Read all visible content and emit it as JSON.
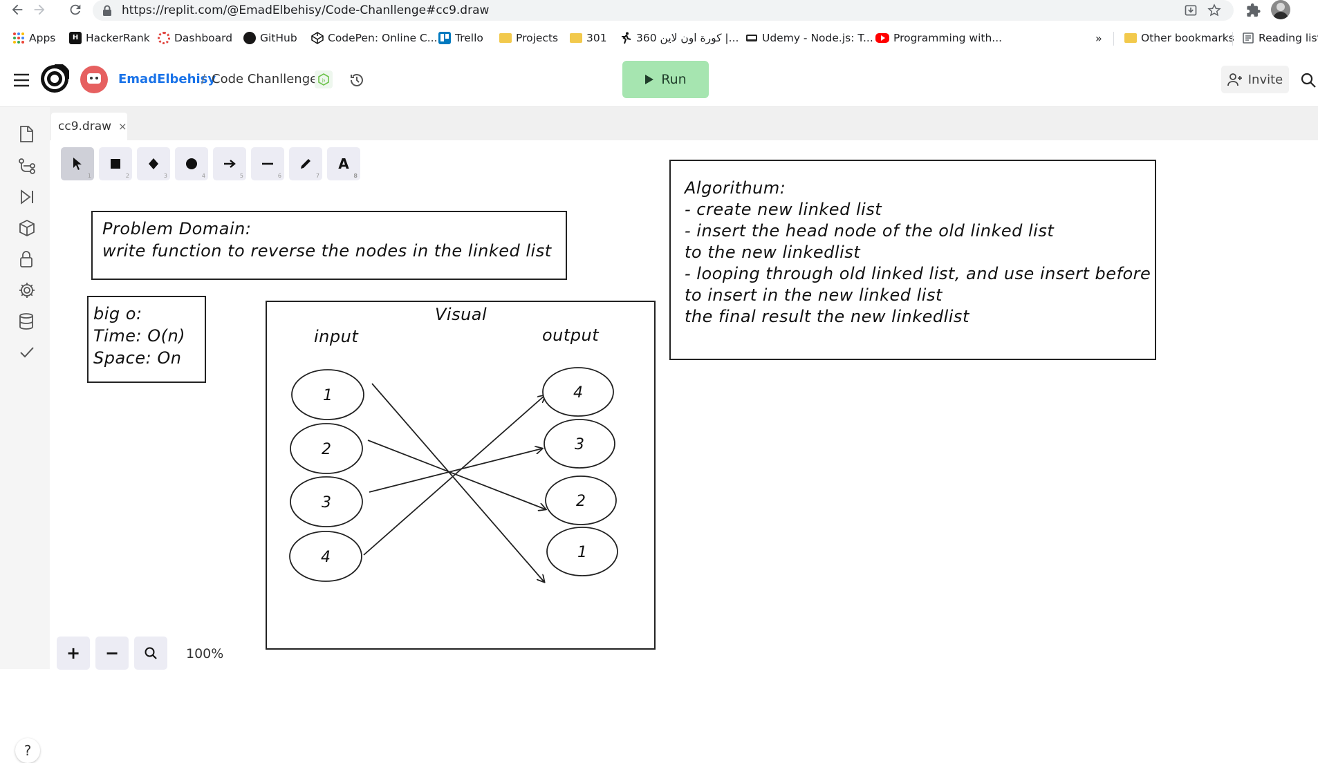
{
  "browser": {
    "url": "https://replit.com/@EmadElbehisy/Code-Chanllenge#cc9.draw",
    "bookmarks": [
      {
        "label": "Apps",
        "icon": "apps-grid-icon"
      },
      {
        "label": "HackerRank",
        "icon": "hackerrank-icon"
      },
      {
        "label": "Dashboard",
        "icon": "dashboard-icon"
      },
      {
        "label": "GitHub",
        "icon": "github-icon"
      },
      {
        "label": "CodePen: Online C...",
        "icon": "codepen-icon"
      },
      {
        "label": "Trello",
        "icon": "trello-icon"
      },
      {
        "label": "Projects",
        "icon": "folder-icon"
      },
      {
        "label": "301",
        "icon": "folder-icon"
      },
      {
        "label": "360 كورة اون لاين |...",
        "icon": "runner-icon"
      },
      {
        "label": "Udemy - Node.js: T...",
        "icon": "udemy-icon"
      },
      {
        "label": "Programming with...",
        "icon": "youtube-icon"
      }
    ],
    "overflow": "»",
    "other_bookmarks": "Other bookmarks",
    "reading_list": "Reading list"
  },
  "header": {
    "user": "EmadElbehisy",
    "separator": "/",
    "repl_name": "Code Chanllenge",
    "run_label": "Run",
    "invite_label": "Invite"
  },
  "tab": {
    "filename": "cc9.draw",
    "close": "×"
  },
  "toolbar": {
    "tools": [
      {
        "name": "select",
        "key": "1"
      },
      {
        "name": "rectangle",
        "key": "2"
      },
      {
        "name": "diamond",
        "key": "3"
      },
      {
        "name": "ellipse",
        "key": "4"
      },
      {
        "name": "arrow",
        "key": "5"
      },
      {
        "name": "line",
        "key": "6"
      },
      {
        "name": "draw",
        "key": "7"
      },
      {
        "name": "text",
        "key": "8",
        "glyph": "A"
      }
    ]
  },
  "drawing": {
    "problem": {
      "line1": "Problem Domain:",
      "line2": "write function to reverse the nodes in the linked list"
    },
    "bigo": {
      "line1": "big o:",
      "line2": "Time: O(n)",
      "line3": "Space: On"
    },
    "algorithm": {
      "lines": [
        "Algorithum:",
        "- create new linked list",
        "- insert the head node of the old linked list",
        "to the new linkedlist",
        "- looping through old linked list, and use insert before",
        "to insert in the new linked list",
        "the final result the new linkedlist"
      ]
    },
    "visual": {
      "title": "Visual",
      "input_label": "input",
      "output_label": "output",
      "input_nodes": [
        "1",
        "2",
        "3",
        "4"
      ],
      "output_nodes": [
        "4",
        "3",
        "2",
        "1"
      ]
    }
  },
  "zoom": {
    "plus": "+",
    "minus": "−",
    "level": "100%"
  },
  "help": "?"
}
